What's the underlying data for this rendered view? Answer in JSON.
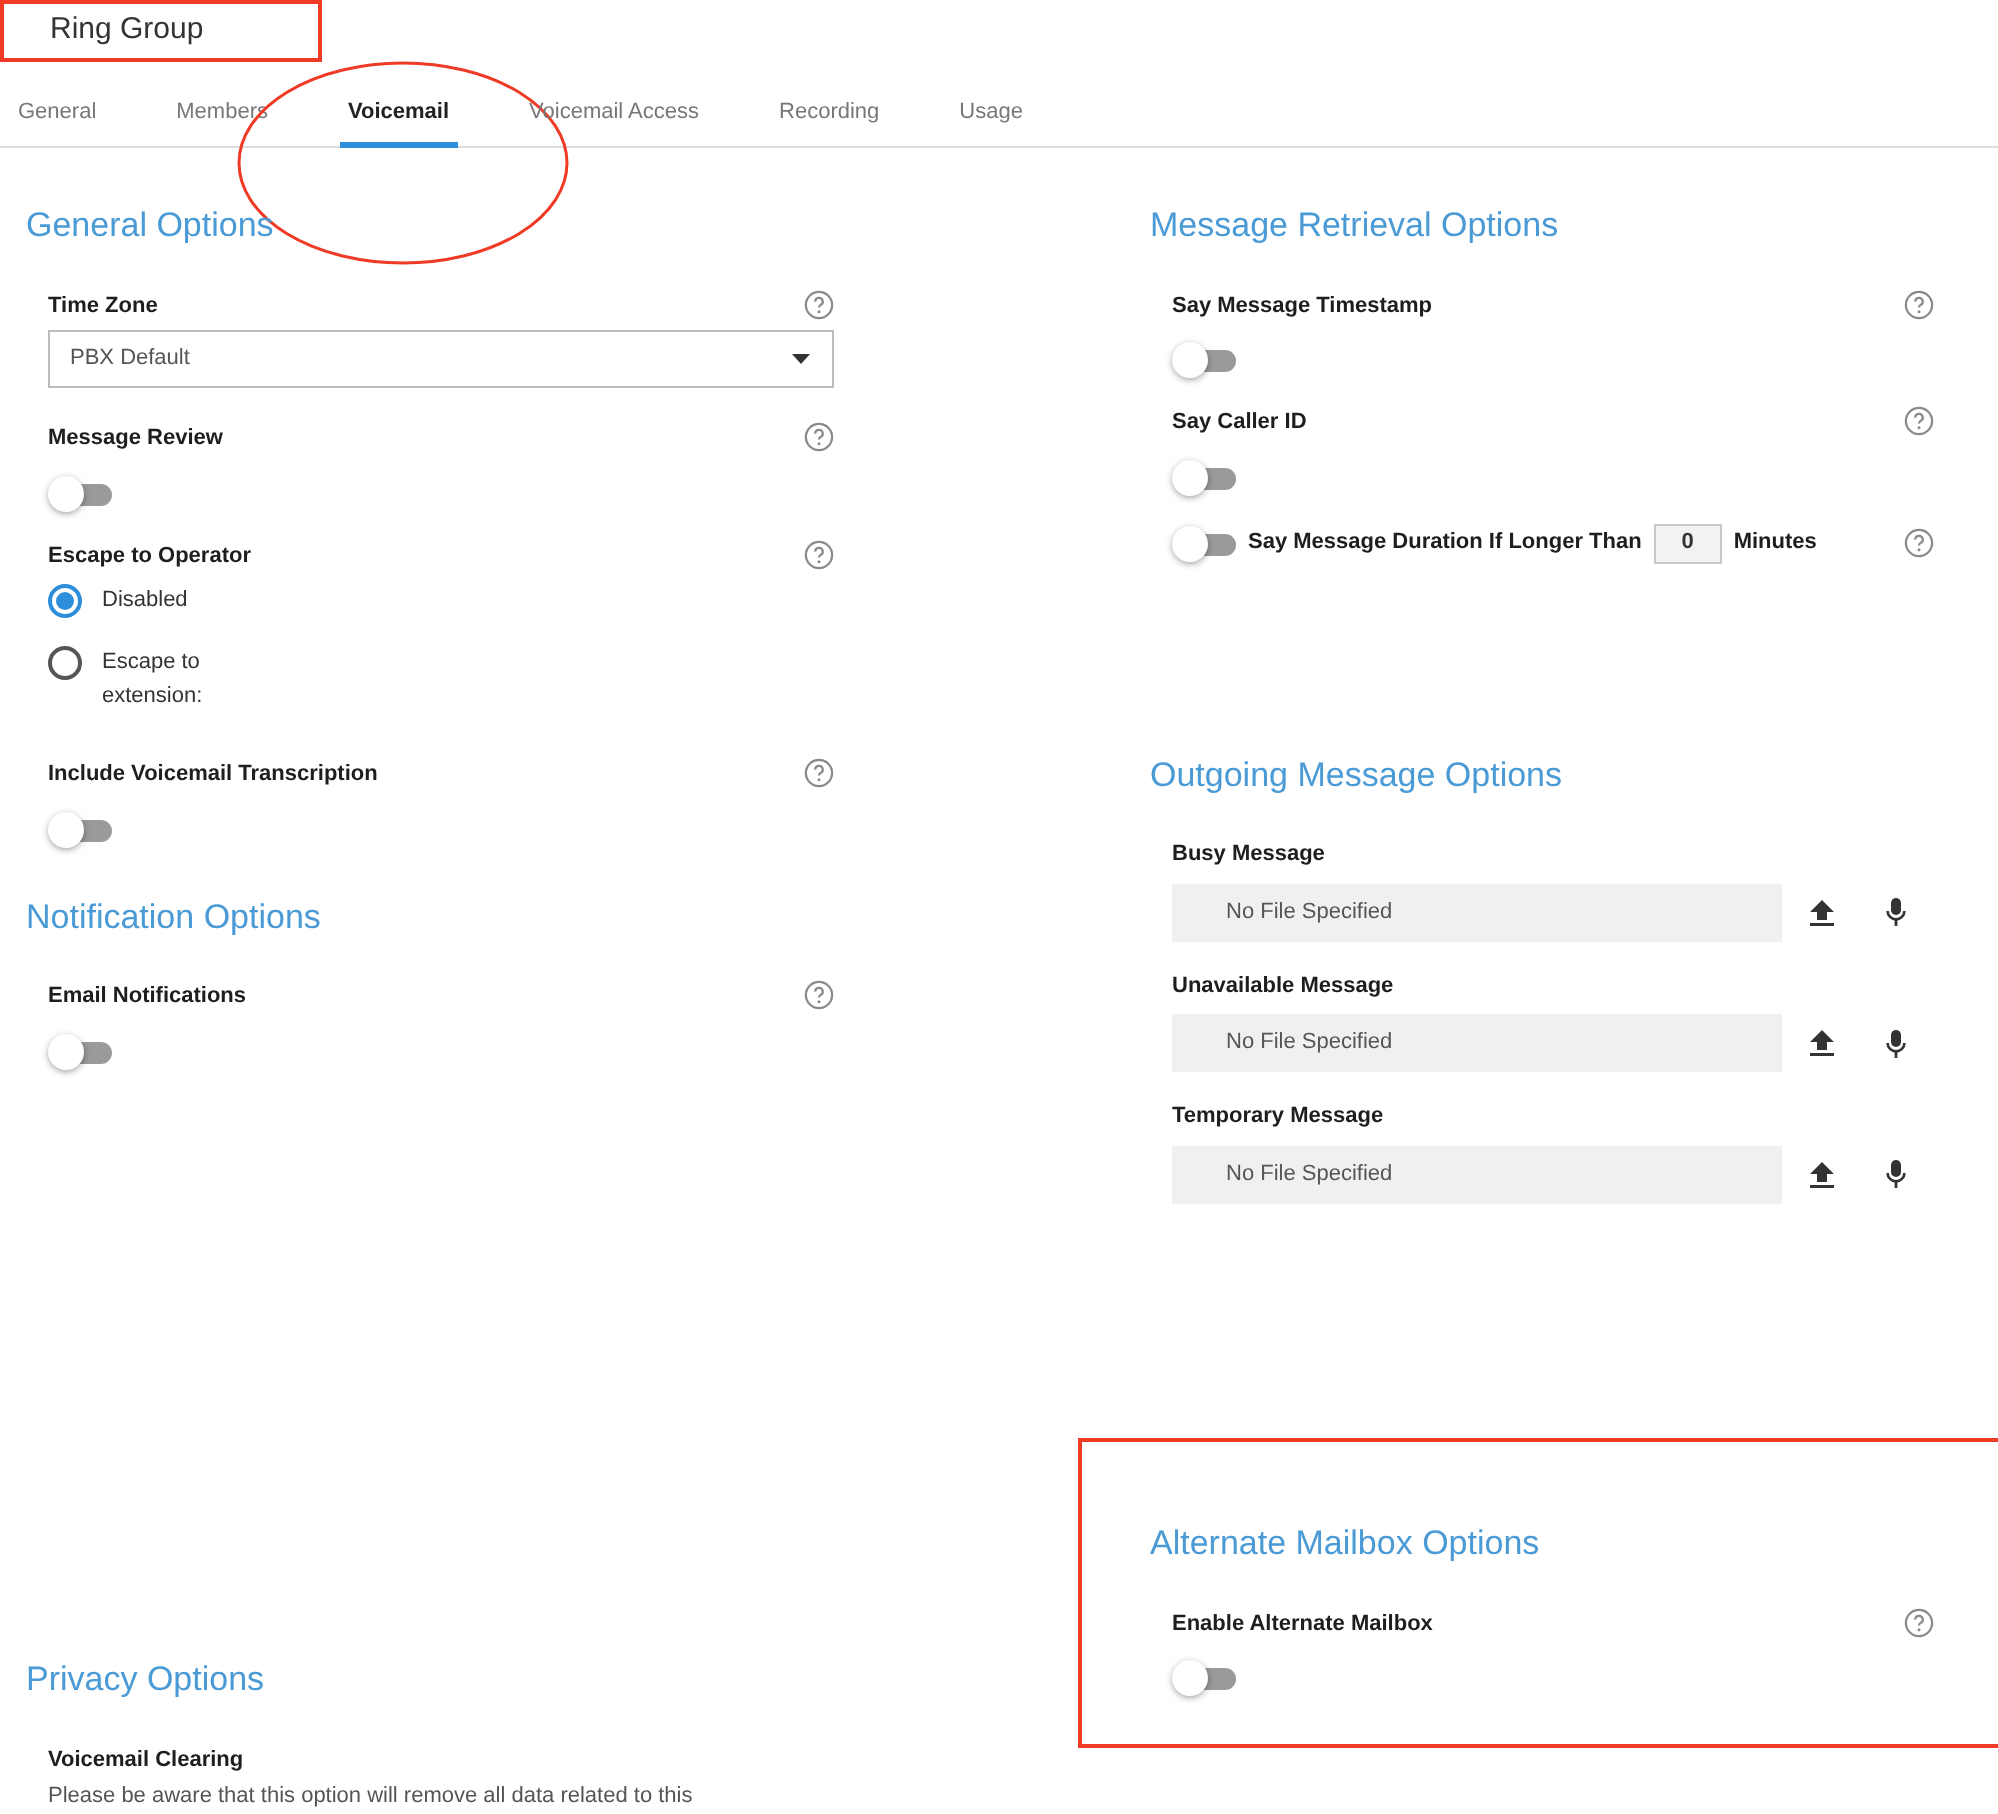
{
  "title": {
    "text": "Ring Group",
    "highlighted": true
  },
  "tabs": [
    {
      "label": "General",
      "selected": false,
      "circled": false
    },
    {
      "label": "Members",
      "selected": false,
      "circled": false
    },
    {
      "label": "Voicemail",
      "selected": true,
      "circled": true
    },
    {
      "label": "Voicemail Access",
      "selected": false,
      "circled": false
    },
    {
      "label": "Recording",
      "selected": false,
      "circled": false
    },
    {
      "label": "Usage",
      "selected": false,
      "circled": false
    }
  ],
  "left_sections": [
    {
      "title": "General Options",
      "highlighted": false,
      "fields": [
        {
          "kind": "select",
          "label": "Time Zone",
          "value": "PBX Default",
          "help": true
        },
        {
          "kind": "toggle",
          "label": "Message Review",
          "on": false,
          "help": true
        },
        {
          "kind": "radio",
          "label": "Escape to Operator",
          "help": true,
          "options": [
            {
              "label": "Disabled",
              "selected": true
            },
            {
              "label": "Escape to extension:",
              "selected": false
            }
          ]
        },
        {
          "kind": "toggle",
          "label": "Include Voicemail Transcription",
          "on": false,
          "help": true
        }
      ]
    },
    {
      "title": "Notification Options",
      "highlighted": false,
      "fields": [
        {
          "kind": "toggle",
          "label": "Email Notifications",
          "on": false,
          "help": true
        }
      ]
    },
    {
      "title": "Privacy Options",
      "highlighted": false,
      "fields": [
        {
          "kind": "note",
          "label": "Voicemail Clearing",
          "text": "Please be aware that this option will remove all data related to this",
          "help": false
        }
      ]
    }
  ],
  "right_sections": [
    {
      "title": "Message Retrieval Options",
      "highlighted": false,
      "fields": [
        {
          "kind": "toggle",
          "label": "Say Message Timestamp",
          "on": false,
          "help": true
        },
        {
          "kind": "toggle",
          "label": "Say Caller ID",
          "on": false,
          "help": true
        },
        {
          "kind": "duration",
          "label": "Say Message Duration If Longer Than",
          "on": false,
          "value": "0",
          "unit": "Minutes",
          "help": true
        }
      ]
    },
    {
      "title": "Outgoing Message Options",
      "highlighted": false,
      "fields": [
        {
          "kind": "file",
          "label": "Busy Message",
          "value": "No File Specified",
          "help": false
        },
        {
          "kind": "file",
          "label": "Unavailable Message",
          "value": "No File Specified",
          "help": false
        },
        {
          "kind": "file",
          "label": "Temporary Message",
          "value": "No File Specified",
          "help": false
        }
      ]
    },
    {
      "title": "Alternate Mailbox Options",
      "highlighted": true,
      "fields": [
        {
          "kind": "toggle",
          "label": "Enable Alternate Mailbox",
          "on": false,
          "help": true
        }
      ]
    }
  ]
}
